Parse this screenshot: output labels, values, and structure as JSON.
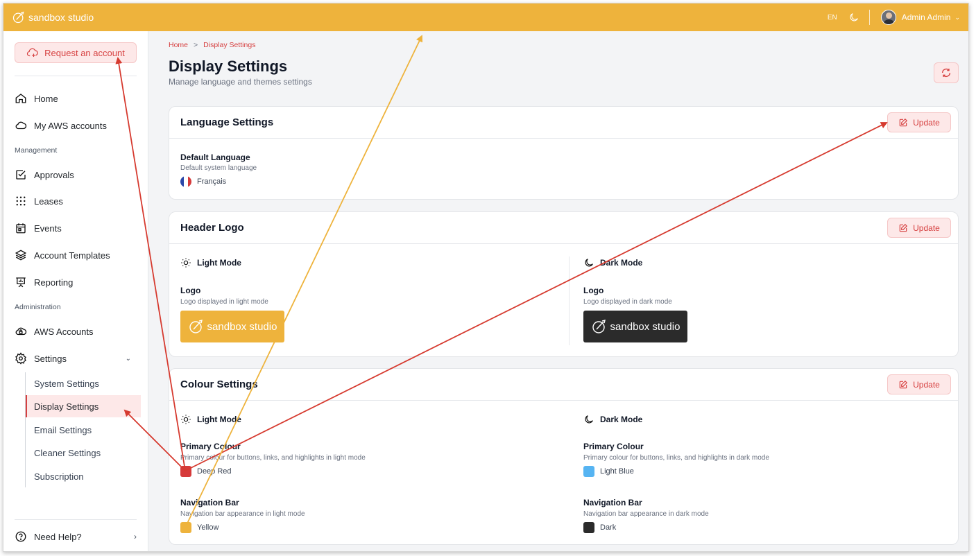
{
  "topbar": {
    "brand": "sandbox studio",
    "language": "EN",
    "user_name": "Admin Admin",
    "color": "#eeb33c"
  },
  "sidebar": {
    "request_button": "Request an account",
    "items": [
      {
        "label": "Home",
        "icon": "home-icon"
      },
      {
        "label": "My AWS accounts",
        "icon": "cloud-icon"
      }
    ],
    "management_label": "Management",
    "management_items": [
      {
        "label": "Approvals",
        "icon": "check-square-icon"
      },
      {
        "label": "Leases",
        "icon": "grid-dots-icon"
      },
      {
        "label": "Events",
        "icon": "calendar-icon"
      },
      {
        "label": "Account Templates",
        "icon": "layers-icon"
      },
      {
        "label": "Reporting",
        "icon": "presentation-icon"
      }
    ],
    "administration_label": "Administration",
    "administration_items": [
      {
        "label": "AWS Accounts",
        "icon": "cloud-lock-icon"
      },
      {
        "label": "Settings",
        "icon": "gear-icon"
      }
    ],
    "settings_sub": [
      {
        "label": "System Settings"
      },
      {
        "label": "Display Settings"
      },
      {
        "label": "Email Settings"
      },
      {
        "label": "Cleaner Settings"
      },
      {
        "label": "Subscription"
      }
    ],
    "help": "Need Help?"
  },
  "breadcrumb": {
    "home": "Home",
    "sep": ">",
    "current": "Display Settings"
  },
  "page": {
    "title": "Display Settings",
    "subtitle": "Manage language and themes settings"
  },
  "language_card": {
    "title": "Language Settings",
    "update": "Update",
    "field_label": "Default Language",
    "field_desc": "Default system language",
    "value": "Français"
  },
  "logo_card": {
    "title": "Header Logo",
    "update": "Update",
    "light_mode": "Light Mode",
    "dark_mode": "Dark Mode",
    "light_logo_label": "Logo",
    "light_logo_desc": "Logo displayed in light mode",
    "dark_logo_label": "Logo",
    "dark_logo_desc": "Logo displayed in dark mode",
    "logo_text": "sandbox studio",
    "light_bg": "#eeb33c",
    "dark_bg": "#2b2b2b"
  },
  "colour_card": {
    "title": "Colour Settings",
    "update": "Update",
    "light_mode": "Light Mode",
    "dark_mode": "Dark Mode",
    "light_primary_label": "Primary Colour",
    "light_primary_desc": "Primary colour for buttons, links, and highlights in light mode",
    "light_primary_value": "Deep Red",
    "light_primary_color": "#d63a3a",
    "dark_primary_label": "Primary Colour",
    "dark_primary_desc": "Primary colour for buttons, links, and highlights in dark mode",
    "dark_primary_value": "Light Blue",
    "dark_primary_color": "#56b4f2",
    "light_nav_label": "Navigation Bar",
    "light_nav_desc": "Navigation bar appearance in light mode",
    "light_nav_value": "Yellow",
    "light_nav_color": "#eeb33c",
    "dark_nav_label": "Navigation Bar",
    "dark_nav_desc": "Navigation bar appearance in dark mode",
    "dark_nav_value": "Dark",
    "dark_nav_color": "#2b2b2b"
  },
  "colors": {
    "accent": "#d64040",
    "accent_bg": "#fde8e8",
    "annotation_red": "#d63a2f",
    "annotation_yellow": "#eeb33c"
  }
}
